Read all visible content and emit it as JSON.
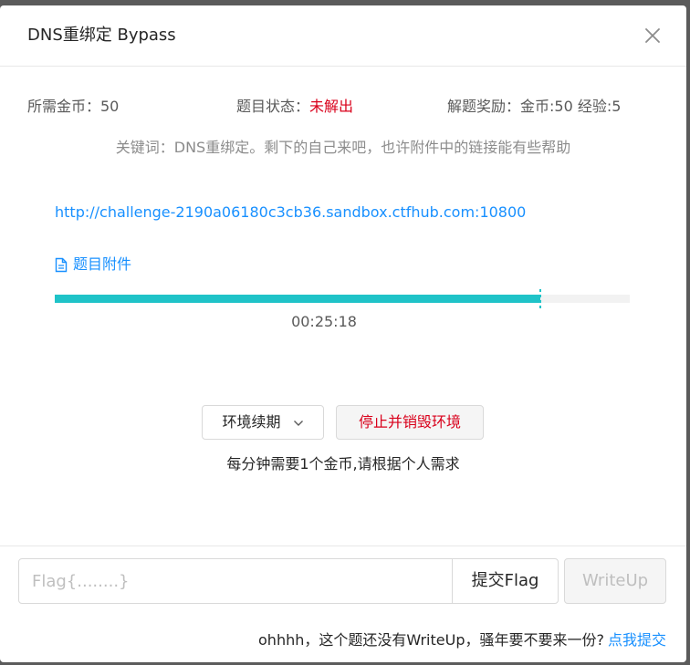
{
  "dialog": {
    "title": "DNS重绑定 Bypass"
  },
  "info": {
    "coins_label": "所需金币：50",
    "status_label": "题目状态：",
    "status_value": "未解出",
    "reward_label": "解题奖励：金币:50 经验:5"
  },
  "keywords": "关键词：DNS重绑定。剩下的自己来吧，也许附件中的链接能有些帮助",
  "challenge": {
    "url": "http://challenge-2190a06180c3cb36.sandbox.ctfhub.com:10800",
    "attachment_label": "题目附件"
  },
  "timer": {
    "remaining": "00:25:18",
    "progress_fraction": 0.845
  },
  "actions": {
    "renew_label": "环境续期",
    "stop_label": "停止并销毁环境",
    "cost_note": "每分钟需要1个金币,请根据个人需求"
  },
  "flag": {
    "placeholder": "Flag{........}",
    "submit_label": "提交Flag",
    "writeup_label": "WriteUp"
  },
  "footer": {
    "note": "ohhhh，这个题还没有WriteUp，骚年要不要来一份?",
    "link_label": "点我提交"
  },
  "colors": {
    "accent": "#1890ff",
    "status_unsolved": "#d9001b",
    "progress": "#1fc3c8"
  }
}
